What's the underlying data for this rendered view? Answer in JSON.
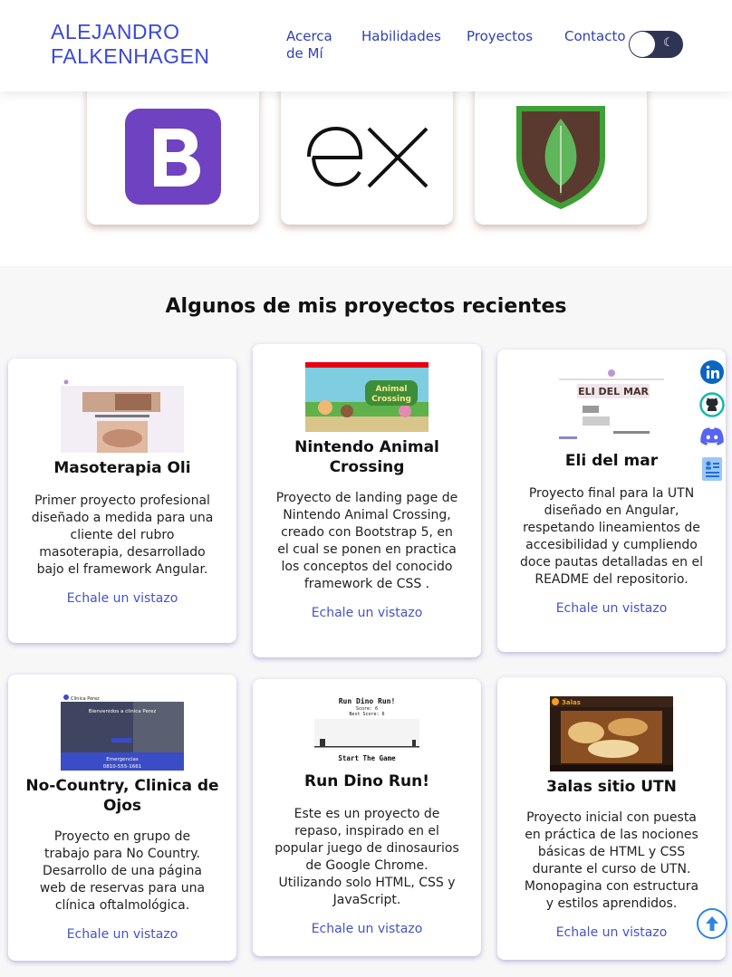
{
  "header": {
    "brand_line1": "ALEJANDRO",
    "brand_line2": "FALKENHAGEN",
    "nav": {
      "about_line1": "Acerca",
      "about_line2": "de Mí",
      "skills": "Habilidades",
      "projects": "Proyectos",
      "contact": "Contacto"
    },
    "theme_toggle_icon": "moon-icon",
    "theme_toggle_glyph": "☾"
  },
  "tech_cards": [
    {
      "icon": "bootstrap-logo-icon"
    },
    {
      "icon": "express-logo-icon"
    },
    {
      "icon": "mongodb-logo-icon"
    }
  ],
  "projects": {
    "title": "Algunos de mis proyectos recientes",
    "link_label": "Echale un vistazo",
    "items": [
      {
        "title": "Masoterapia Oli",
        "description": "Primer proyecto profesional diseñado a medida para una cliente del rubro masoterapia, desarrollado bajo el framework Angular.",
        "link": "Echale un vistazo"
      },
      {
        "title": "Nintendo Animal Crossing",
        "description": "Proyecto de landing page de Nintendo Animal Crossing, creado con Bootstrap 5, en el cual se ponen en practica los conceptos del conocido framework de CSS .",
        "link": "Echale un vistazo"
      },
      {
        "title": "Eli del mar",
        "description": "Proyecto final para la UTN diseñado en Angular, respetando lineamientos de accesibilidad y cumpliendo doce pautas detalladas en el README del repositorio.",
        "link": "Echale un vistazo"
      },
      {
        "title": "No-Country, Clinica de Ojos",
        "description": "Proyecto en grupo de trabajo para No Country. Desarrollo de una página web de reservas para una clínica oftalmológica.",
        "link": "Echale un vistazo"
      },
      {
        "title": "Run Dino Run!",
        "description": "Este es un proyecto de repaso, inspirado en el popular juego de dinosaurios de Google Chrome. Utilizando solo HTML, CSS y JavaScript.",
        "link": "Echale un vistazo"
      },
      {
        "title": "3alas sitio UTN",
        "description": "Proyecto inicial con puesta en práctica de las nociones básicas de HTML y CSS durante el curso de UTN. Monopagina con estructura y estilos aprendidos.",
        "link": "Echale un vistazo"
      }
    ]
  },
  "thumbnails": {
    "dino_title": "Run Dino Run!",
    "dino_score": "Score: 6",
    "dino_best": "Best Score: 6",
    "dino_start": "Start The Game",
    "clinic_brand": "Clínica Pérez",
    "clinic_welcome": "Bienvenidos a clinica Perez",
    "clinic_emergency": "Emergencias",
    "clinic_phone": "0810-555-1661",
    "animal_crossing_logo_line1": "Animal",
    "animal_crossing_logo_line2": "Crossing",
    "eli_logo": "ELI DEL MAR",
    "alas_brand": "3alas"
  },
  "socials": [
    {
      "icon": "linkedin-icon"
    },
    {
      "icon": "github-icon"
    },
    {
      "icon": "discord-icon"
    },
    {
      "icon": "contact-card-icon"
    }
  ],
  "scroll_top_icon": "arrow-up-circle-icon",
  "colors": {
    "brand": "#3b48d6",
    "nav": "#3040b8",
    "link": "#4552c7",
    "toggle": "#2f3454"
  }
}
